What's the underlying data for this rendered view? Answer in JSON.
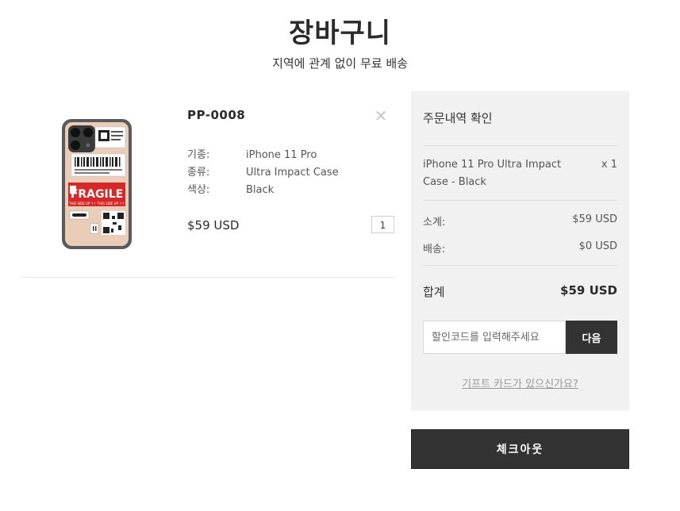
{
  "page": {
    "title": "장바구니",
    "subtitle": "지역에 관계 없이 무료 배송"
  },
  "cart_item": {
    "sku": "PP-0008",
    "specs": [
      {
        "label": "기종:",
        "value": "iPhone 11 Pro"
      },
      {
        "label": "종류:",
        "value": "Ultra Impact Case"
      },
      {
        "label": "색상:",
        "value": "Black"
      }
    ],
    "price": "$59 USD",
    "quantity": "1",
    "remove_icon": "close-icon",
    "image_text": {
      "fragile": "FRAGILE",
      "side_up": "THIS SIDE UP ↑↑ THIS SIDE UP ↑↑"
    }
  },
  "summary": {
    "title": "주문내역 확인",
    "line_item_name": "iPhone 11 Pro Ultra Impact Case - Black",
    "line_item_qty": "x 1",
    "subtotal_label": "소계:",
    "subtotal_value": "$59 USD",
    "shipping_label": "배송:",
    "shipping_value": "$0 USD",
    "total_label": "합계",
    "total_value": "$59 USD",
    "coupon_placeholder": "할인코드를 입력해주세요",
    "coupon_button": "다음",
    "gift_card_link": "기프트 카드가 있으신가요?"
  },
  "checkout": {
    "label": "체크아웃"
  },
  "colors": {
    "accent_dark": "#333333",
    "panel_bg": "#f1f1f1",
    "fragile_red": "#d62828"
  }
}
